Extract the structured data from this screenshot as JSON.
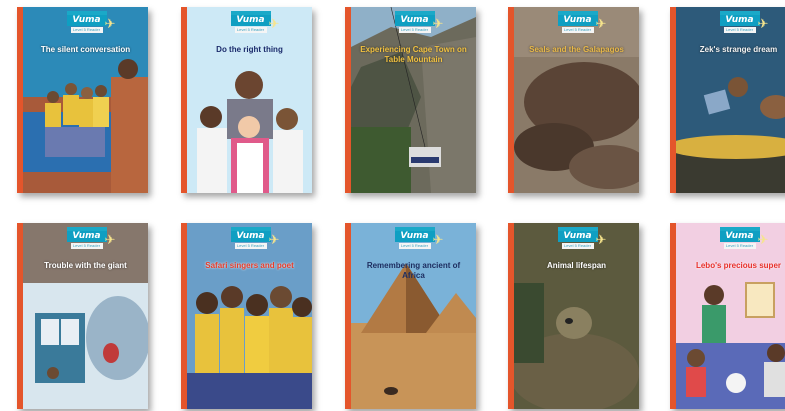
{
  "books": [
    {
      "title": "The silent conversation",
      "title_color": "#ffffff",
      "bg": "#2c8ab8"
    },
    {
      "title": "Do the right thing",
      "title_color": "#1b2b6b",
      "bg": "#cde9f6"
    },
    {
      "title": "Experiencing Cape Town on Table Mountain",
      "title_color": "#f0c040",
      "bg": "#5c6c52"
    },
    {
      "title": "Seals and the Galapagos",
      "title_color": "#e8b848",
      "bg": "#6a5040"
    },
    {
      "title": "Zek's strange dream",
      "title_color": "#f2f2f2",
      "bg": "#2d5a7a"
    },
    {
      "title": "Trouble with the giant",
      "title_color": "#ffffff",
      "bg": "#86776c"
    },
    {
      "title": "Safari singers and poet",
      "title_color": "#e83c2a",
      "bg": "#6a9ec8"
    },
    {
      "title": "Remembering ancient of Africa",
      "title_color": "#1e2e60",
      "bg": "#b78a50"
    },
    {
      "title": "Animal lifespan",
      "title_color": "#ffffff",
      "bg": "#5c5a3e"
    },
    {
      "title": "Lebo's precious super",
      "title_color": "#e8302a",
      "bg": "#f2cfe2"
    }
  ],
  "logo": {
    "brand": "Vuma",
    "tagline": "Level 5 Reader",
    "plane_icon": "airplane-icon"
  },
  "colors": {
    "spine": "#e4552b",
    "brand": "#0f9fc2"
  }
}
